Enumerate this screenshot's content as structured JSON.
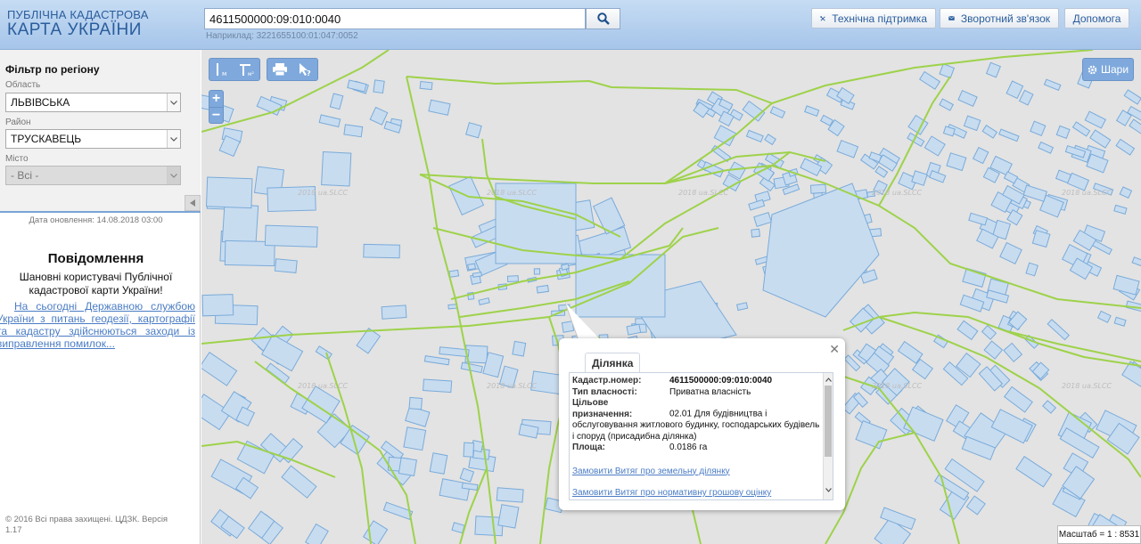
{
  "header": {
    "logo_line1": "ПУБЛІЧНА КАДАСТРОВА",
    "logo_line2": "КАРТА УКРАЇНИ",
    "search_value": "4611500000:09:010:0040",
    "search_example": "Наприклад: 3221655100:01:047:0052",
    "buttons": {
      "support": "Технічна підтримка",
      "feedback": "Зворотний зв'язок",
      "help": "Допомога"
    }
  },
  "sidebar": {
    "filter_title": "Фільтр по регіону",
    "region_label": "Область",
    "region_value": "ЛЬВІВСЬКА",
    "district_label": "Район",
    "district_value": "ТРУСКАВЕЦЬ",
    "city_label": "Місто",
    "city_value": "- Всі -",
    "updated": "Дата оновлення: 14.08.2018 03:00",
    "notice_title": "Повідомлення",
    "notice_text": "Шановні користувачі Публічної кадастрової карти України!",
    "notice_link": "На сьогодні Державною службою України з питань геодезії, картографії та кадастру здійснюються заходи із виправлення помилок...",
    "copyright": "© 2016 Всі права захищені. ЦДЗК. Версія 1.17"
  },
  "map": {
    "layers_button": "Шари",
    "scale": "Масштаб = 1 : 8531",
    "watermark": "2018 ua.SLCC",
    "colors": {
      "parcel_fill": "#c8dcf0",
      "parcel_stroke": "#7aabd9",
      "boundary": "#9ed24a",
      "background": "#e3e3e3"
    }
  },
  "popup": {
    "tab": "Ділянка",
    "cadastral_label": "Кадастр.номер:",
    "cadastral_value": "4611500000:09:010:0040",
    "ownership_label": "Тип власності:",
    "ownership_value": "Приватна власність",
    "purpose_label": "Цільове призначення:",
    "purpose_value": "02.01 Для будівництва і обслуговування житлового будинку, господарських будівель і споруд (присадибна ділянка)",
    "area_label": "Площа:",
    "area_value": "0.0186 га",
    "link1": "Замовити Витяг про земельну ділянку",
    "link2": "Замовити Витяг про нормативну грошову оцінку"
  }
}
